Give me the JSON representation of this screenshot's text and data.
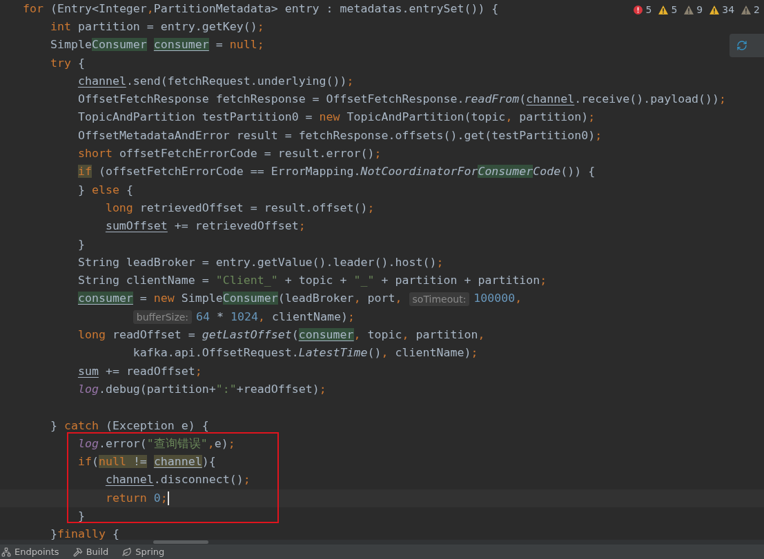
{
  "inspections": [
    {
      "kind": "error",
      "count": "5"
    },
    {
      "kind": "warning",
      "count": "5"
    },
    {
      "kind": "weak",
      "count": "9"
    },
    {
      "kind": "warning",
      "count": "34"
    },
    {
      "kind": "weak",
      "count": "2"
    }
  ],
  "annotations": [
    {
      "kind": "rectangle",
      "color": "#e0141e"
    }
  ],
  "lines": [
    {
      "current": false,
      "tokens": [
        {
          "kind": "keyword",
          "text": "for"
        },
        {
          "kind": "plain",
          "text": " (Entry<Integer"
        },
        {
          "kind": "keyword",
          "text": ","
        },
        {
          "kind": "plain",
          "text": "PartitionMetadata> entry : metadatas.entrySet()) {"
        }
      ]
    },
    {
      "current": false,
      "tokens": [
        {
          "kind": "keyword",
          "text": "    int"
        },
        {
          "kind": "plain",
          "text": " partition = entry.getKey()"
        },
        {
          "kind": "keyword",
          "text": ";"
        }
      ]
    },
    {
      "current": false,
      "tokens": [
        {
          "kind": "plain",
          "text": "    Simple"
        },
        {
          "kind": "plain",
          "text": "Consumer ",
          "usage": true
        },
        {
          "kind": "plain",
          "text": "consumer",
          "usage": true,
          "underline": true
        },
        {
          "kind": "plain",
          "text": " = "
        },
        {
          "kind": "keyword",
          "text": "null"
        },
        {
          "kind": "keyword",
          "text": ";"
        }
      ]
    },
    {
      "current": false,
      "tokens": [
        {
          "kind": "keyword",
          "text": "    try"
        },
        {
          "kind": "plain",
          "text": " {"
        }
      ]
    },
    {
      "current": false,
      "tokens": [
        {
          "kind": "plain",
          "text": "        channel",
          "underline": true
        },
        {
          "kind": "plain",
          "text": ".send(fetchRequest.underlying())"
        },
        {
          "kind": "keyword",
          "text": ";"
        }
      ]
    },
    {
      "current": false,
      "tokens": [
        {
          "kind": "plain",
          "text": "        OffsetFetchResponse fetchResponse = OffsetFetchResponse."
        },
        {
          "kind": "italic",
          "text": "readFrom"
        },
        {
          "kind": "plain",
          "text": "("
        },
        {
          "kind": "plain",
          "text": "channel",
          "underline": true
        },
        {
          "kind": "plain",
          "text": ".receive().payload())"
        },
        {
          "kind": "keyword",
          "text": ";"
        }
      ]
    },
    {
      "current": false,
      "tokens": [
        {
          "kind": "plain",
          "text": "        TopicAndPartition testPartition0 = "
        },
        {
          "kind": "keyword",
          "text": "new"
        },
        {
          "kind": "plain",
          "text": " TopicAndPartition(topic"
        },
        {
          "kind": "keyword",
          "text": ","
        },
        {
          "kind": "plain",
          "text": " partition)"
        },
        {
          "kind": "keyword",
          "text": ";"
        }
      ]
    },
    {
      "current": false,
      "tokens": [
        {
          "kind": "plain",
          "text": "        OffsetMetadataAndError result = fetchResponse.offsets().get(testPartition0)"
        },
        {
          "kind": "keyword",
          "text": ";"
        }
      ]
    },
    {
      "current": false,
      "tokens": [
        {
          "kind": "keyword",
          "text": "        short"
        },
        {
          "kind": "plain",
          "text": " offsetFetchErrorCode = result.error()"
        },
        {
          "kind": "keyword",
          "text": ";"
        }
      ]
    },
    {
      "current": false,
      "tokens": [
        {
          "kind": "keyword",
          "text": "        if",
          "match": true
        },
        {
          "kind": "plain",
          "text": " (offsetFetchErrorCode == ErrorMapping."
        },
        {
          "kind": "italic",
          "text": "NotCoordinatorFor"
        },
        {
          "kind": "italic",
          "text": "Consumer",
          "usage": true
        },
        {
          "kind": "italic",
          "text": "Code"
        },
        {
          "kind": "plain",
          "text": "()) {"
        }
      ]
    },
    {
      "current": false,
      "tokens": [
        {
          "kind": "plain",
          "text": "        } "
        },
        {
          "kind": "keyword",
          "text": "else"
        },
        {
          "kind": "plain",
          "text": " {"
        }
      ]
    },
    {
      "current": false,
      "tokens": [
        {
          "kind": "keyword",
          "text": "            long"
        },
        {
          "kind": "plain",
          "text": " retrievedOffset = result.offset()"
        },
        {
          "kind": "keyword",
          "text": ";"
        }
      ]
    },
    {
      "current": false,
      "tokens": [
        {
          "kind": "plain",
          "text": "            sumOffset",
          "underline": true
        },
        {
          "kind": "plain",
          "text": " += retrievedOffset"
        },
        {
          "kind": "keyword",
          "text": ";"
        }
      ]
    },
    {
      "current": false,
      "tokens": [
        {
          "kind": "plain",
          "text": "        }"
        }
      ]
    },
    {
      "current": false,
      "tokens": [
        {
          "kind": "plain",
          "text": "        String leadBroker = entry.getValue().leader().host()"
        },
        {
          "kind": "keyword",
          "text": ";"
        }
      ]
    },
    {
      "current": false,
      "tokens": [
        {
          "kind": "plain",
          "text": "        String clientName = "
        },
        {
          "kind": "string",
          "text": "\"Client_\""
        },
        {
          "kind": "plain",
          "text": " + topic + "
        },
        {
          "kind": "string",
          "text": "\"_\""
        },
        {
          "kind": "plain",
          "text": " + partition + partition"
        },
        {
          "kind": "keyword",
          "text": ";"
        }
      ]
    },
    {
      "current": false,
      "tokens": [
        {
          "kind": "plain",
          "text": "        consumer",
          "usage": true,
          "underline": true
        },
        {
          "kind": "plain",
          "text": " = "
        },
        {
          "kind": "keyword",
          "text": "new"
        },
        {
          "kind": "plain",
          "text": " Simple"
        },
        {
          "kind": "plain",
          "text": "Consumer",
          "usage": true
        },
        {
          "kind": "plain",
          "text": "(leadBroker"
        },
        {
          "kind": "keyword",
          "text": ","
        },
        {
          "kind": "plain",
          "text": " port"
        },
        {
          "kind": "keyword",
          "text": ", "
        },
        {
          "kind": "hint",
          "text": "soTimeout:"
        },
        {
          "kind": "number",
          "text": "100000"
        },
        {
          "kind": "keyword",
          "text": ","
        }
      ]
    },
    {
      "current": false,
      "tokens": [
        {
          "kind": "hint",
          "text": "                bufferSize:"
        },
        {
          "kind": "number",
          "text": "64"
        },
        {
          "kind": "plain",
          "text": " * "
        },
        {
          "kind": "number",
          "text": "1024"
        },
        {
          "kind": "keyword",
          "text": ","
        },
        {
          "kind": "plain",
          "text": " clientName)"
        },
        {
          "kind": "keyword",
          "text": ";"
        }
      ]
    },
    {
      "current": false,
      "tokens": [
        {
          "kind": "keyword",
          "text": "        long"
        },
        {
          "kind": "plain",
          "text": " readOffset = "
        },
        {
          "kind": "italic",
          "text": "getLastOffset"
        },
        {
          "kind": "plain",
          "text": "("
        },
        {
          "kind": "plain",
          "text": "consumer",
          "usage": true,
          "underline": true
        },
        {
          "kind": "keyword",
          "text": ","
        },
        {
          "kind": "plain",
          "text": " topic"
        },
        {
          "kind": "keyword",
          "text": ","
        },
        {
          "kind": "plain",
          "text": " partition"
        },
        {
          "kind": "keyword",
          "text": ","
        }
      ]
    },
    {
      "current": false,
      "tokens": [
        {
          "kind": "plain",
          "text": "                kafka.api.OffsetRequest."
        },
        {
          "kind": "italic",
          "text": "LatestTime"
        },
        {
          "kind": "plain",
          "text": "()"
        },
        {
          "kind": "keyword",
          "text": ","
        },
        {
          "kind": "plain",
          "text": " clientName)"
        },
        {
          "kind": "keyword",
          "text": ";"
        }
      ]
    },
    {
      "current": false,
      "tokens": [
        {
          "kind": "plain",
          "text": "        sum",
          "underline": true
        },
        {
          "kind": "plain",
          "text": " += readOffset"
        },
        {
          "kind": "keyword",
          "text": ";"
        }
      ]
    },
    {
      "current": false,
      "tokens": [
        {
          "kind": "field",
          "text": "        log"
        },
        {
          "kind": "plain",
          "text": ".debug(partition+"
        },
        {
          "kind": "string",
          "text": "\":\""
        },
        {
          "kind": "plain",
          "text": "+readOffset)"
        },
        {
          "kind": "keyword",
          "text": ";"
        }
      ]
    },
    {
      "current": false
    },
    {
      "current": false,
      "tokens": [
        {
          "kind": "plain",
          "text": "    } "
        },
        {
          "kind": "keyword",
          "text": "catch"
        },
        {
          "kind": "plain",
          "text": " (Exception e) {"
        }
      ]
    },
    {
      "current": false,
      "tokens": [
        {
          "kind": "field",
          "text": "        log"
        },
        {
          "kind": "plain",
          "text": ".error("
        },
        {
          "kind": "string",
          "text": "\"查询错误\""
        },
        {
          "kind": "keyword",
          "text": ","
        },
        {
          "kind": "plain",
          "text": "e)"
        },
        {
          "kind": "keyword",
          "text": ";"
        }
      ]
    },
    {
      "current": false,
      "tokens": [
        {
          "kind": "keyword",
          "text": "        if"
        },
        {
          "kind": "plain",
          "text": "("
        },
        {
          "kind": "keyword",
          "text": "null",
          "match": true
        },
        {
          "kind": "plain",
          "text": " != ",
          "match": true
        },
        {
          "kind": "plain",
          "text": "channel",
          "match": true,
          "underline": true
        },
        {
          "kind": "plain",
          "text": "){"
        }
      ]
    },
    {
      "current": false,
      "tokens": [
        {
          "kind": "plain",
          "text": "            channel",
          "underline": true
        },
        {
          "kind": "plain",
          "text": ".disconnect()"
        },
        {
          "kind": "keyword",
          "text": ";"
        }
      ]
    },
    {
      "current": true,
      "tokens": [
        {
          "kind": "keyword",
          "text": "            return"
        },
        {
          "kind": "number",
          "text": " 0"
        },
        {
          "kind": "keyword",
          "text": ";"
        }
      ]
    },
    {
      "current": false,
      "tokens": [
        {
          "kind": "plain",
          "text": "        }"
        }
      ]
    },
    {
      "current": false,
      "tokens": [
        {
          "kind": "plain",
          "text": "    }"
        },
        {
          "kind": "keyword",
          "text": "finally"
        },
        {
          "kind": "plain",
          "text": " {"
        }
      ]
    }
  ],
  "tool_windows": [
    {
      "kind": "network",
      "label": "Endpoints"
    },
    {
      "kind": "hammer",
      "label": "Build"
    },
    {
      "kind": "leaf",
      "label": "Spring"
    }
  ]
}
